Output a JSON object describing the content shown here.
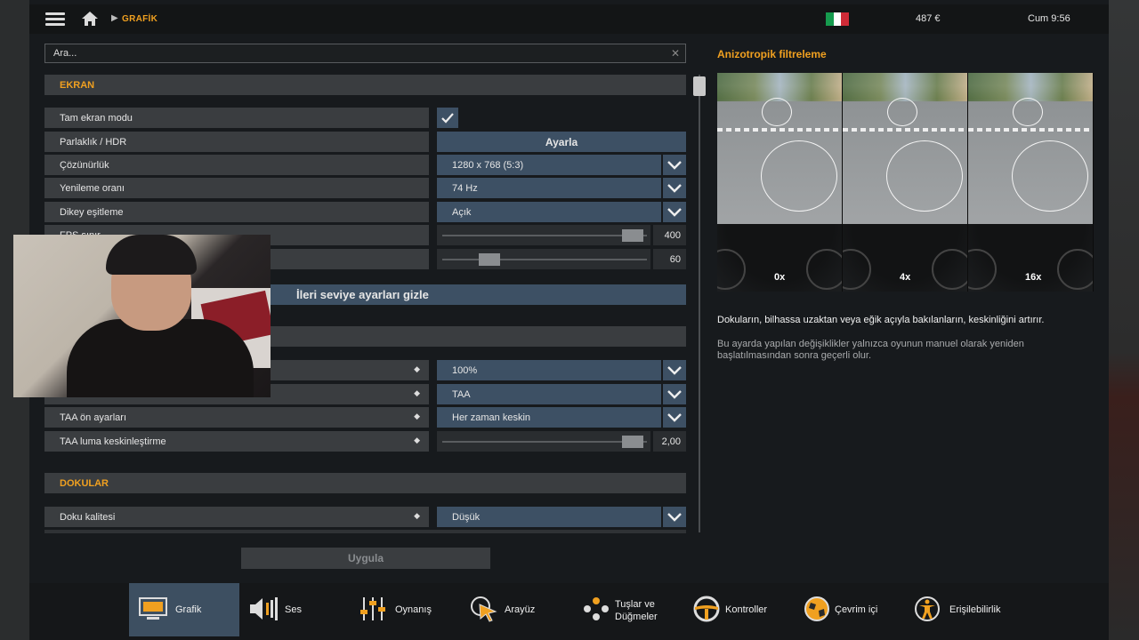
{
  "topbar": {
    "breadcrumb": "GRAFİK",
    "money": "487 €",
    "clock": "Cum 9:56",
    "flag_colors": [
      "#169b4e",
      "#ffffff",
      "#cf2b37"
    ]
  },
  "search": {
    "placeholder": "Ara..."
  },
  "sections": {
    "ekran": "EKRAN",
    "dokular": "DOKULAR"
  },
  "rows": {
    "fullscreen": {
      "label": "Tam ekran modu",
      "checked": true
    },
    "brightness": {
      "label": "Parlaklık / HDR",
      "button": "Ayarla"
    },
    "resolution": {
      "label": "Çözünürlük",
      "value": "1280 x 768 (5:3)"
    },
    "refresh": {
      "label": "Yenileme oranı",
      "value": "74 Hz"
    },
    "vsync": {
      "label": "Dikey eşitleme",
      "value": "Açık"
    },
    "fps_cap": {
      "label": "FPS sınır",
      "value": "400",
      "fraction": 0.98
    },
    "fov": {
      "label": "",
      "value": "60",
      "fraction": 0.2
    },
    "scaling": {
      "label": "",
      "value": "100%"
    },
    "antialias": {
      "label": "",
      "value": "TAA"
    },
    "taa_preset": {
      "label": "TAA ön ayarları",
      "value": "Her zaman keskin"
    },
    "taa_luma": {
      "label": "TAA luma keskinleştirme",
      "value": "2,00",
      "fraction": 0.98
    },
    "texture_quality": {
      "label": "Doku kalitesi",
      "value": "Düşük"
    }
  },
  "advanced_toggle": "İleri seviye ayarları gizle",
  "apply_button": "Uygula",
  "info": {
    "title": "Anizotropik filtreleme",
    "panels": [
      "0x",
      "4x",
      "16x"
    ],
    "description": "Dokuların, bilhassa uzaktan veya eğik açıyla bakılanların, keskinliğini artırır.",
    "note": "Bu ayarda yapılan değişiklikler yalnızca oyunun manuel olarak yeniden başlatılmasından sonra geçerli olur."
  },
  "bottom_nav": [
    {
      "label": "Grafik",
      "icon": "monitor-icon",
      "active": true
    },
    {
      "label": "Ses",
      "icon": "speaker-icon"
    },
    {
      "label": "Oynanış",
      "icon": "sliders-icon"
    },
    {
      "label": "Arayüz",
      "icon": "cursor-icon"
    },
    {
      "label": "Tuşlar ve",
      "label2": "Düğmeler",
      "icon": "gamepad-icon"
    },
    {
      "label": "Kontroller",
      "icon": "steering-wheel-icon"
    },
    {
      "label": "Çevrim içi",
      "icon": "globe-icon"
    },
    {
      "label": "Erişilebilirlik",
      "icon": "accessibility-icon"
    }
  ],
  "colors": {
    "accent": "#f0a020",
    "control": "#3d5064",
    "row": "#3a3d40"
  }
}
